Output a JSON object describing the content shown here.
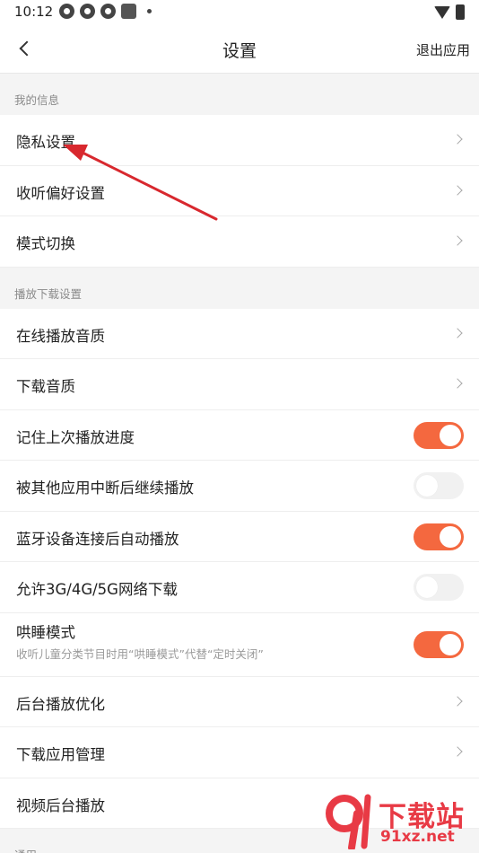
{
  "status_bar": {
    "time": "10:12",
    "icons": [
      "app-notification-icon",
      "app-notification-icon",
      "app-notification-icon",
      "square-notification-icon",
      "dot-icon",
      "wifi-icon",
      "battery-icon"
    ]
  },
  "nav": {
    "title": "设置",
    "exit_label": "退出应用"
  },
  "sections": {
    "my_info": {
      "header": "我的信息",
      "items": [
        {
          "label": "隐私设置"
        },
        {
          "label": "收听偏好设置"
        },
        {
          "label": "模式切换"
        }
      ]
    },
    "playback": {
      "header": "播放下载设置",
      "items": [
        {
          "label": "在线播放音质"
        },
        {
          "label": "下载音质"
        },
        {
          "label": "记住上次播放进度",
          "on": true
        },
        {
          "label": "被其他应用中断后继续播放",
          "on": false
        },
        {
          "label": "蓝牙设备连接后自动播放",
          "on": true
        },
        {
          "label": "允许3G/4G/5G网络下载",
          "on": false
        },
        {
          "label": "哄睡模式",
          "sub": "收听儿童分类节目时用“哄睡模式”代替“定时关闭”",
          "on": true
        }
      ]
    },
    "misc": {
      "items": [
        {
          "label": "后台播放优化"
        },
        {
          "label": "下载应用管理"
        },
        {
          "label": "视频后台播放"
        }
      ]
    },
    "general": {
      "header": "通用"
    }
  },
  "colors": {
    "accent": "#f4683f",
    "arrow": "#d8282e",
    "watermark": "#e83a45"
  },
  "watermark": {
    "text": "下载站",
    "url": "91xz.net"
  }
}
